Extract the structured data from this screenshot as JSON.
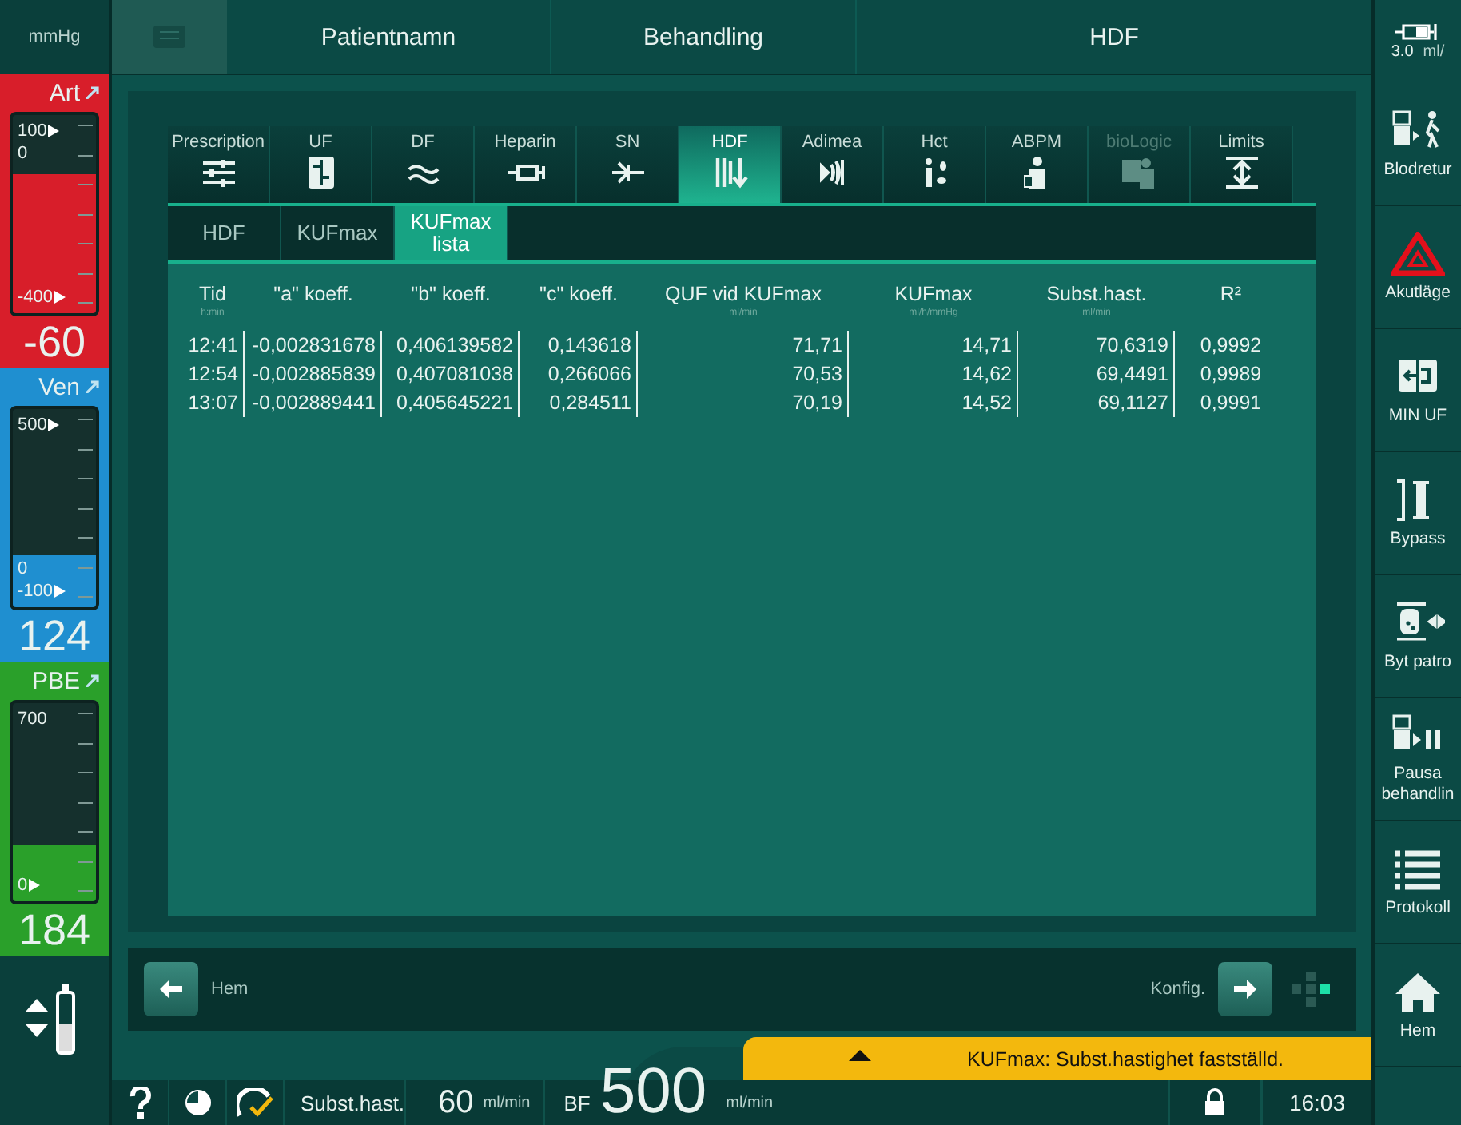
{
  "unit_label": "mmHg",
  "pressures": [
    {
      "name": "Art",
      "color": "#d81e2a",
      "top_labels": [
        {
          "text": "100",
          "marker": true
        },
        {
          "text": "0",
          "marker": false
        }
      ],
      "bottom_labels": [
        {
          "text": "-400",
          "marker": true
        }
      ],
      "level": 0.7,
      "value": "-60"
    },
    {
      "name": "Ven",
      "color": "#1f8fd0",
      "top_labels": [
        {
          "text": "500",
          "marker": true
        }
      ],
      "bottom_labels": [
        {
          "text": "0",
          "marker": false
        },
        {
          "text": "-100",
          "marker": true
        }
      ],
      "level": 0.27,
      "value": "124"
    },
    {
      "name": "PBE",
      "color": "#2aa02a",
      "top_labels": [
        {
          "text": "700",
          "marker": false
        }
      ],
      "bottom_labels": [
        {
          "text": "0",
          "marker": true
        }
      ],
      "level": 0.28,
      "value": "184"
    }
  ],
  "header": {
    "patient": "Patientnamn",
    "section": "Behandling",
    "mode": "HDF"
  },
  "tabs": [
    {
      "label": "Prescription",
      "selected": false,
      "disabled": false
    },
    {
      "label": "UF",
      "selected": false,
      "disabled": false
    },
    {
      "label": "DF",
      "selected": false,
      "disabled": false
    },
    {
      "label": "Heparin",
      "selected": false,
      "disabled": false
    },
    {
      "label": "SN",
      "selected": false,
      "disabled": false
    },
    {
      "label": "HDF",
      "selected": true,
      "disabled": false
    },
    {
      "label": "Adimea",
      "selected": false,
      "disabled": false
    },
    {
      "label": "Hct",
      "selected": false,
      "disabled": false
    },
    {
      "label": "ABPM",
      "selected": false,
      "disabled": false
    },
    {
      "label": "bioLogic",
      "selected": false,
      "disabled": true
    },
    {
      "label": "Limits",
      "selected": false,
      "disabled": false
    }
  ],
  "subtabs": [
    {
      "label": "HDF",
      "selected": false
    },
    {
      "label": "KUFmax",
      "selected": false
    },
    {
      "label": "KUFmax lista",
      "selected": true
    }
  ],
  "table": {
    "columns": [
      {
        "label": "Tid",
        "unit": "h:min"
      },
      {
        "label": "\"a\" koeff."
      },
      {
        "label": "\"b\" koeff."
      },
      {
        "label": "\"c\" koeff."
      },
      {
        "label": "QUF vid KUFmax",
        "unit": "ml/min"
      },
      {
        "label": "KUFmax",
        "unit": "ml/h/mmHg"
      },
      {
        "label": "Subst.hast.",
        "unit": "ml/min"
      },
      {
        "label": "R²"
      }
    ],
    "rows": [
      [
        "12:41",
        "-0,002831678",
        "0,406139582",
        "0,143618",
        "71,71",
        "14,71",
        "70,6319",
        "0,9992"
      ],
      [
        "12:54",
        "-0,002885839",
        "0,407081038",
        "0,266066",
        "70,53",
        "14,62",
        "69,4491",
        "0,9989"
      ],
      [
        "13:07",
        "-0,002889441",
        "0,405645221",
        "0,284511",
        "70,19",
        "14,52",
        "69,1127",
        "0,9991"
      ]
    ]
  },
  "nav": {
    "back": "Hem",
    "forward": "Konfig."
  },
  "message": "KUFmax: Subst.hastighet fastställd.",
  "status": {
    "subst_label": "Subst.hast.",
    "subst_value": "60",
    "subst_unit": "ml/min",
    "bf_label": "BF",
    "bf_value": "500",
    "bf_unit": "ml/min",
    "time": "16:03"
  },
  "right": {
    "rate_value": "3.0",
    "rate_unit": "ml/",
    "buttons": [
      "Blodretur",
      "Akutläge",
      "MIN UF",
      "Bypass",
      "Byt patro",
      "Pausa behandlin",
      "Protokoll",
      "Hem"
    ]
  }
}
